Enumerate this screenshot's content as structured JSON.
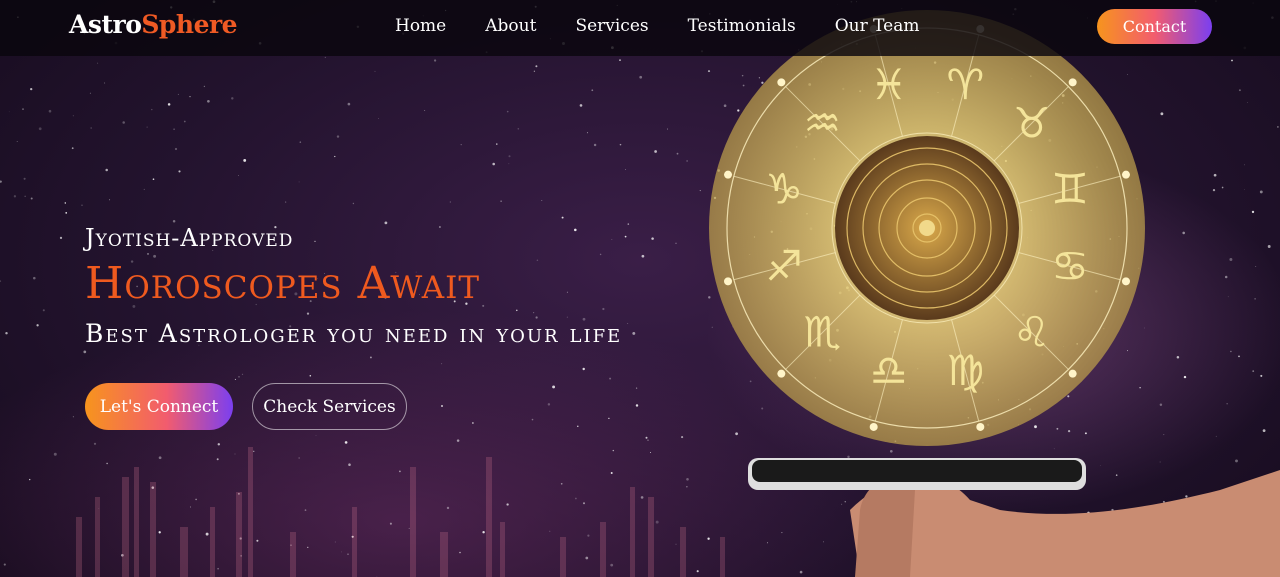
{
  "brand": {
    "part1": "Astro",
    "part2": "Sphere"
  },
  "nav": {
    "items": [
      "Home",
      "About",
      "Services",
      "Testimonials",
      "Our Team"
    ],
    "contact_label": "Contact"
  },
  "hero": {
    "eyebrow": "Jyotish-Approved",
    "headline": "Horoscopes Await",
    "subline": "Best Astrologer you need in your life",
    "primary_button": "Let's Connect",
    "secondary_button": "Check Services"
  },
  "zodiac_glyphs": [
    "♓",
    "♈",
    "♉",
    "♊",
    "♋",
    "♌",
    "♍",
    "♎",
    "♏",
    "♐",
    "♑",
    "♒"
  ],
  "colors": {
    "accent": "#ef5a24",
    "gradient_start": "#f7941d",
    "gradient_mid": "#f25c6e",
    "gradient_end": "#7b3ff0",
    "gold": "#e9d27a"
  }
}
